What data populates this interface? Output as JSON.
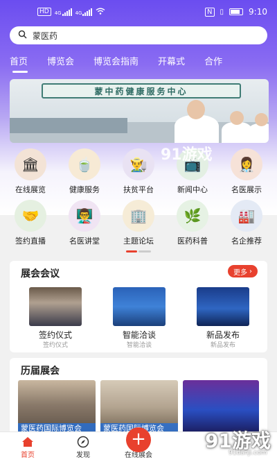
{
  "status_bar": {
    "left": "HD",
    "signal1": "4G",
    "signal2": "4G",
    "time": "9:10"
  },
  "search": {
    "value": "蒙医药"
  },
  "tabs": [
    {
      "label": "首页"
    },
    {
      "label": "博览会"
    },
    {
      "label": "博览会指南"
    },
    {
      "label": "开幕式"
    },
    {
      "label": "合作"
    }
  ],
  "banner": {
    "sign": "蒙中药健康服务中心"
  },
  "watermark": {
    "brand": "91游戏",
    "url": "91danji.com"
  },
  "categories": [
    {
      "label": "在线展览",
      "icon": "exhibition-icon",
      "color": "#f3e3d6"
    },
    {
      "label": "健康服务",
      "icon": "health-service-icon",
      "color": "#f7ead5"
    },
    {
      "label": "扶贫平台",
      "icon": "poverty-relief-icon",
      "color": "#e9e2f3"
    },
    {
      "label": "新闻中心",
      "icon": "news-center-icon",
      "color": "#e3efe3"
    },
    {
      "label": "名医展示",
      "icon": "doctor-showcase-icon",
      "color": "#f6e2d8"
    },
    {
      "label": "签约直播",
      "icon": "signing-live-icon",
      "color": "#e5f0e1"
    },
    {
      "label": "名医讲堂",
      "icon": "doctor-lecture-icon",
      "color": "#f0e4f3"
    },
    {
      "label": "主题论坛",
      "icon": "theme-forum-icon",
      "color": "#f6ecd7"
    },
    {
      "label": "医药科普",
      "icon": "medicine-science-icon",
      "color": "#e6f2e4"
    },
    {
      "label": "名企推荐",
      "icon": "company-recommend-icon",
      "color": "#e4eaf5"
    }
  ],
  "meetings": {
    "title": "展会会议",
    "more_label": "更多",
    "items": [
      {
        "title": "签约仪式",
        "subtitle": "签约仪式"
      },
      {
        "title": "智能洽谈",
        "subtitle": "智能洽谈"
      },
      {
        "title": "新品发布",
        "subtitle": "新品发布"
      }
    ]
  },
  "history": {
    "title": "历届展会",
    "items": [
      {
        "caption": "蒙医药国际博览会"
      },
      {
        "caption": "蒙医药国际博览会"
      },
      {
        "caption": ""
      }
    ]
  },
  "bottom_nav": [
    {
      "label": "首页"
    },
    {
      "label": "发现"
    },
    {
      "label": "在线展会"
    }
  ],
  "colors": {
    "accent": "#e8412e",
    "header": "#6b4df0"
  }
}
